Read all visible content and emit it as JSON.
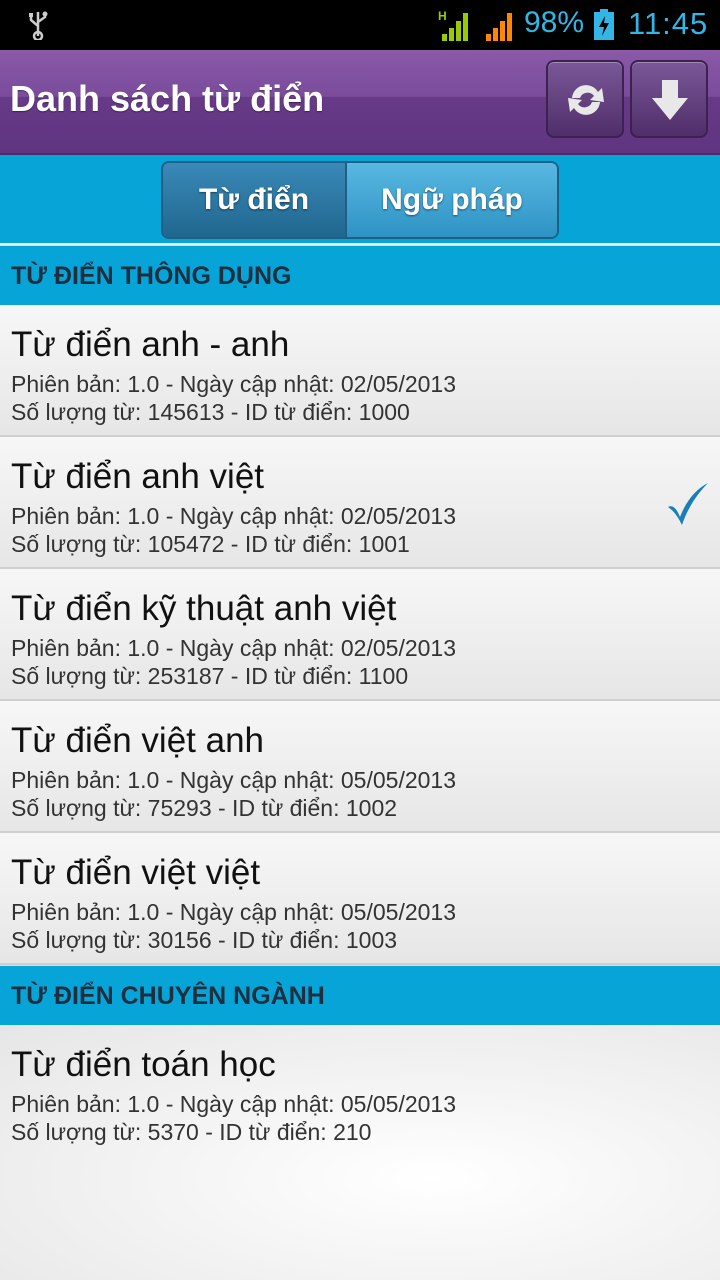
{
  "status_bar": {
    "battery_percent": "98%",
    "time": "11:45",
    "icons": [
      "usb-icon",
      "signal-h-icon",
      "signal-icon",
      "battery-charging-icon"
    ],
    "accent_color": "#33b5e5"
  },
  "action_bar": {
    "title": "Danh sách từ điển",
    "buttons": [
      "refresh-icon",
      "download-icon"
    ],
    "color": "#6b3f8c"
  },
  "tabs": {
    "items": [
      "Từ điển",
      "Ngữ pháp"
    ],
    "selected": "Từ điển"
  },
  "sections": [
    {
      "header": "TỪ ĐIỂN THÔNG DỤNG",
      "items": [
        {
          "name": "Từ điển anh - anh",
          "meta1": "Phiên bản: 1.0 - Ngày cập nhật: 02/05/2013",
          "meta2": "Số lượng từ: 145613 - ID từ điển: 1000",
          "selected": false
        },
        {
          "name": "Từ điển anh việt",
          "meta1": "Phiên bản: 1.0 - Ngày cập nhật: 02/05/2013",
          "meta2": "Số lượng từ: 105472 - ID từ điển: 1001",
          "selected": true
        },
        {
          "name": "Từ điển kỹ thuật anh việt",
          "meta1": "Phiên bản: 1.0 - Ngày cập nhật: 02/05/2013",
          "meta2": "Số lượng từ: 253187 - ID từ điển: 1100",
          "selected": false
        },
        {
          "name": "Từ điển việt anh",
          "meta1": "Phiên bản: 1.0 - Ngày cập nhật: 05/05/2013",
          "meta2": "Số lượng từ: 75293 - ID từ điển: 1002",
          "selected": false
        },
        {
          "name": "Từ điển việt việt",
          "meta1": "Phiên bản: 1.0 - Ngày cập nhật: 05/05/2013",
          "meta2": "Số lượng từ: 30156 - ID từ điển: 1003",
          "selected": false
        }
      ]
    },
    {
      "header": "TỪ ĐIỂN CHUYÊN NGÀNH",
      "items": [
        {
          "name": "Từ điển toán học",
          "meta1": "Phiên bản: 1.0 - Ngày cập nhật: 05/05/2013",
          "meta2": "Số lượng từ: 5370 - ID từ điển: 210",
          "selected": false
        }
      ]
    }
  ],
  "section_color": "#07a4d8",
  "check_color": "#1a7fb5"
}
